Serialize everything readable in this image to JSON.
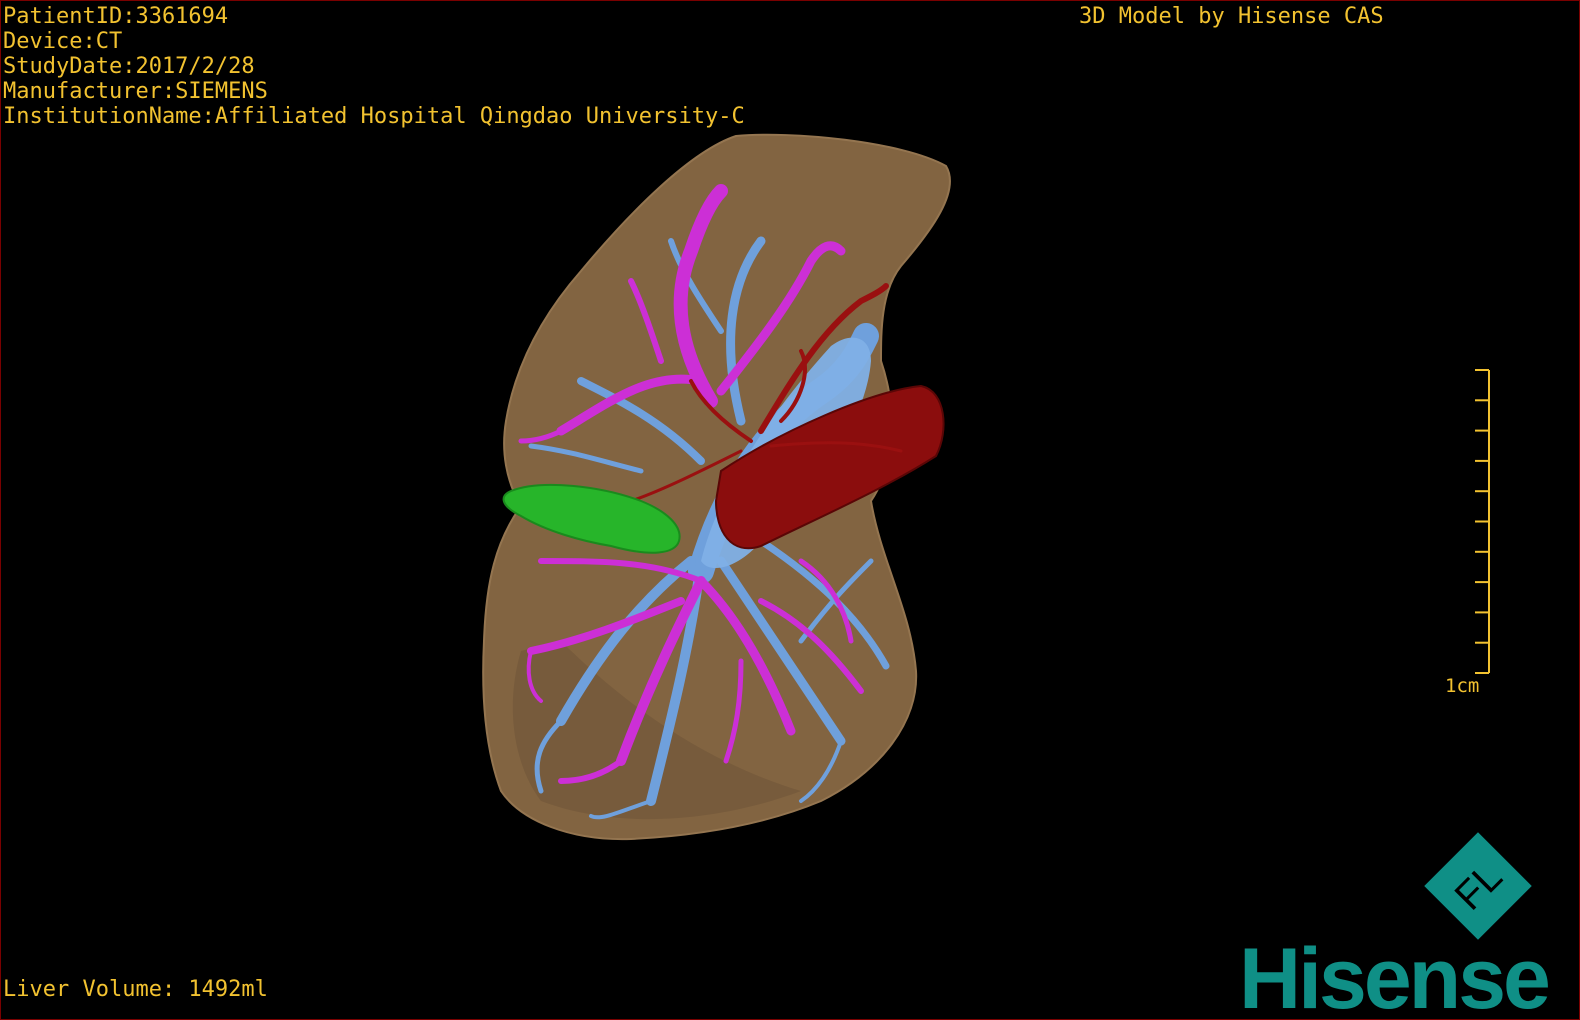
{
  "overlay": {
    "patient_id": "PatientID:3361694",
    "device": "Device:CT",
    "study_date": "StudyDate:2017/2/28",
    "manufacturer": "Manufacturer:SIEMENS",
    "institution": "InstitutionName:Affiliated Hospital Qingdao University-C",
    "model_by": "3D Model by Hisense CAS",
    "liver_volume": "Liver Volume: 1492ml"
  },
  "scale_bar": {
    "label": "1cm",
    "tick_count": 11
  },
  "logo": {
    "emblem_letters": "FL",
    "wordmark": "Hisense"
  },
  "colors": {
    "overlay_text": "#f2c230",
    "liver": "#8a6a45",
    "portal_vein": "#cc2fd6",
    "hepatic_vein": "#6fa0dc",
    "artery": "#8b0d0d",
    "lesion": "#27b52a",
    "brand": "#0f8f86"
  }
}
